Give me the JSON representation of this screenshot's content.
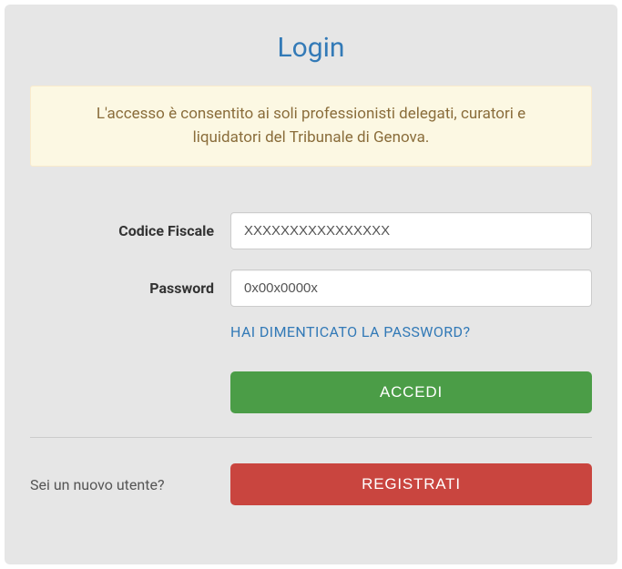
{
  "title": "Login",
  "alert": "L'accesso è consentito ai soli professionisti delegati, curatori e liquidatori del Tribunale di Genova.",
  "form": {
    "codice_fiscale_label": "Codice Fiscale",
    "codice_fiscale_value": "XXXXXXXXXXXXXXXX",
    "password_label": "Password",
    "password_value": "0x00x0000x",
    "forgot_link": "HAI DIMENTICATO LA PASSWORD?",
    "login_button": "ACCEDI"
  },
  "register": {
    "prompt": "Sei un nuovo utente?",
    "button": "REGISTRATI"
  }
}
